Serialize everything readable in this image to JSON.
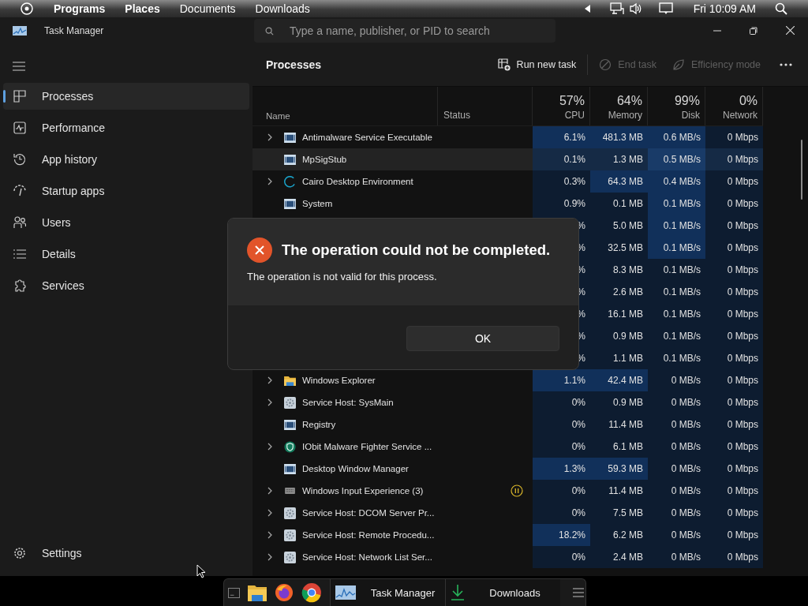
{
  "top_bar": {
    "menu": [
      {
        "label": "Programs",
        "bold": true
      },
      {
        "label": "Places",
        "bold": true
      },
      {
        "label": "Documents",
        "bold": false
      },
      {
        "label": "Downloads",
        "bold": false
      }
    ],
    "clock": "Fri 10:09 AM"
  },
  "window": {
    "title": "Task Manager",
    "search": {
      "placeholder": "Type a name, publisher, or PID to search"
    }
  },
  "sidebar": {
    "items": [
      {
        "label": "Processes",
        "selected": true
      },
      {
        "label": "Performance",
        "selected": false
      },
      {
        "label": "App history",
        "selected": false
      },
      {
        "label": "Startup apps",
        "selected": false
      },
      {
        "label": "Users",
        "selected": false
      },
      {
        "label": "Details",
        "selected": false
      },
      {
        "label": "Services",
        "selected": false
      }
    ],
    "settings": "Settings"
  },
  "toolbar": {
    "title": "Processes",
    "actions": [
      {
        "label": "Run new task",
        "disabled": false
      },
      {
        "label": "End task",
        "disabled": true
      },
      {
        "label": "Efficiency mode",
        "disabled": true
      }
    ]
  },
  "table": {
    "columns": [
      {
        "label": "Name"
      },
      {
        "label": "Status"
      },
      {
        "label": "CPU",
        "total": "57%"
      },
      {
        "label": "Memory",
        "total": "64%"
      },
      {
        "label": "Disk",
        "total": "99%"
      },
      {
        "label": "Network",
        "total": "0%"
      }
    ],
    "rows": [
      {
        "name": "Antimalware Service Executable",
        "kind": "app",
        "expandable": true,
        "selected": false,
        "suspended": false,
        "cpu": {
          "text": "6.1%",
          "hot": true
        },
        "memory": {
          "text": "481.3 MB",
          "hot": true
        },
        "disk": {
          "text": "0.6 MB/s",
          "hot": true
        },
        "network": {
          "text": "0 Mbps",
          "hot": false
        }
      },
      {
        "name": "MpSigStub",
        "kind": "app",
        "expandable": false,
        "selected": true,
        "suspended": false,
        "cpu": {
          "text": "0.1%",
          "hot": false
        },
        "memory": {
          "text": "1.3 MB",
          "hot": false
        },
        "disk": {
          "text": "0.5 MB/s",
          "hot": true
        },
        "network": {
          "text": "0 Mbps",
          "hot": false
        }
      },
      {
        "name": "Cairo Desktop Environment",
        "kind": "ring",
        "expandable": true,
        "selected": false,
        "suspended": false,
        "cpu": {
          "text": "0.3%",
          "hot": false
        },
        "memory": {
          "text": "64.3 MB",
          "hot": true
        },
        "disk": {
          "text": "0.4 MB/s",
          "hot": true
        },
        "network": {
          "text": "0 Mbps",
          "hot": false
        }
      },
      {
        "name": "System",
        "kind": "app",
        "expandable": false,
        "selected": false,
        "suspended": false,
        "cpu": {
          "text": "0.9%",
          "hot": false
        },
        "memory": {
          "text": "0.1 MB",
          "hot": false
        },
        "disk": {
          "text": "0.1 MB/s",
          "hot": true
        },
        "network": {
          "text": "0 Mbps",
          "hot": false
        }
      },
      {
        "selected": false,
        "cpu": {
          "text": "%",
          "hot": false
        },
        "memory": {
          "text": "5.0 MB",
          "hot": false
        },
        "disk": {
          "text": "0.1 MB/s",
          "hot": true
        },
        "network": {
          "text": "0 Mbps",
          "hot": false
        }
      },
      {
        "selected": false,
        "cpu": {
          "text": "%",
          "hot": false
        },
        "memory": {
          "text": "32.5 MB",
          "hot": false
        },
        "disk": {
          "text": "0.1 MB/s",
          "hot": true
        },
        "network": {
          "text": "0 Mbps",
          "hot": false
        }
      },
      {
        "selected": false,
        "cpu": {
          "text": "%",
          "hot": false
        },
        "memory": {
          "text": "8.3 MB",
          "hot": false
        },
        "disk": {
          "text": "0.1 MB/s",
          "hot": false
        },
        "network": {
          "text": "0 Mbps",
          "hot": false
        }
      },
      {
        "selected": false,
        "cpu": {
          "text": "%",
          "hot": false
        },
        "memory": {
          "text": "2.6 MB",
          "hot": false
        },
        "disk": {
          "text": "0.1 MB/s",
          "hot": false
        },
        "network": {
          "text": "0 Mbps",
          "hot": false
        }
      },
      {
        "selected": false,
        "cpu": {
          "text": "%",
          "hot": false
        },
        "memory": {
          "text": "16.1 MB",
          "hot": false
        },
        "disk": {
          "text": "0.1 MB/s",
          "hot": false
        },
        "network": {
          "text": "0 Mbps",
          "hot": false
        }
      },
      {
        "selected": false,
        "cpu": {
          "text": "%",
          "hot": false
        },
        "memory": {
          "text": "0.9 MB",
          "hot": false
        },
        "disk": {
          "text": "0.1 MB/s",
          "hot": false
        },
        "network": {
          "text": "0 Mbps",
          "hot": false
        }
      },
      {
        "selected": false,
        "cpu": {
          "text": "%",
          "hot": false
        },
        "memory": {
          "text": "1.1 MB",
          "hot": false
        },
        "disk": {
          "text": "0.1 MB/s",
          "hot": false
        },
        "network": {
          "text": "0 Mbps",
          "hot": false
        }
      },
      {
        "name": "Windows Explorer",
        "kind": "folder",
        "expandable": true,
        "selected": false,
        "suspended": false,
        "cpu": {
          "text": "1.1%",
          "hot": true
        },
        "memory": {
          "text": "42.4 MB",
          "hot": true
        },
        "disk": {
          "text": "0 MB/s",
          "hot": false
        },
        "network": {
          "text": "0 Mbps",
          "hot": false
        }
      },
      {
        "name": "Service Host: SysMain",
        "kind": "gear",
        "expandable": true,
        "selected": false,
        "suspended": false,
        "cpu": {
          "text": "0%",
          "hot": false
        },
        "memory": {
          "text": "0.9 MB",
          "hot": false
        },
        "disk": {
          "text": "0 MB/s",
          "hot": false
        },
        "network": {
          "text": "0 Mbps",
          "hot": false
        }
      },
      {
        "name": "Registry",
        "kind": "app",
        "expandable": false,
        "selected": false,
        "suspended": false,
        "cpu": {
          "text": "0%",
          "hot": false
        },
        "memory": {
          "text": "11.4 MB",
          "hot": false
        },
        "disk": {
          "text": "0 MB/s",
          "hot": false
        },
        "network": {
          "text": "0 Mbps",
          "hot": false
        }
      },
      {
        "name": "IObit Malware Fighter Service ...",
        "kind": "shield",
        "expandable": true,
        "selected": false,
        "suspended": false,
        "cpu": {
          "text": "0%",
          "hot": false
        },
        "memory": {
          "text": "6.1 MB",
          "hot": false
        },
        "disk": {
          "text": "0 MB/s",
          "hot": false
        },
        "network": {
          "text": "0 Mbps",
          "hot": false
        }
      },
      {
        "name": "Desktop Window Manager",
        "kind": "app",
        "expandable": false,
        "selected": false,
        "suspended": false,
        "cpu": {
          "text": "1.3%",
          "hot": true
        },
        "memory": {
          "text": "59.3 MB",
          "hot": true
        },
        "disk": {
          "text": "0 MB/s",
          "hot": false
        },
        "network": {
          "text": "0 Mbps",
          "hot": false
        }
      },
      {
        "name": "Windows Input Experience (3)",
        "kind": "keyboard",
        "expandable": true,
        "selected": false,
        "suspended": true,
        "cpu": {
          "text": "0%",
          "hot": false
        },
        "memory": {
          "text": "11.4 MB",
          "hot": false
        },
        "disk": {
          "text": "0 MB/s",
          "hot": false
        },
        "network": {
          "text": "0 Mbps",
          "hot": false
        }
      },
      {
        "name": "Service Host: DCOM Server Pr...",
        "kind": "gear",
        "expandable": true,
        "selected": false,
        "suspended": false,
        "cpu": {
          "text": "0%",
          "hot": false
        },
        "memory": {
          "text": "7.5 MB",
          "hot": false
        },
        "disk": {
          "text": "0 MB/s",
          "hot": false
        },
        "network": {
          "text": "0 Mbps",
          "hot": false
        }
      },
      {
        "name": "Service Host: Remote Procedu...",
        "kind": "gear",
        "expandable": true,
        "selected": false,
        "suspended": false,
        "cpu": {
          "text": "18.2%",
          "hot": true
        },
        "memory": {
          "text": "6.2 MB",
          "hot": false
        },
        "disk": {
          "text": "0 MB/s",
          "hot": false
        },
        "network": {
          "text": "0 Mbps",
          "hot": false
        }
      },
      {
        "name": "Service Host: Network List Ser...",
        "kind": "gear",
        "expandable": true,
        "selected": false,
        "suspended": false,
        "cpu": {
          "text": "0%",
          "hot": false
        },
        "memory": {
          "text": "2.4 MB",
          "hot": false
        },
        "disk": {
          "text": "0 MB/s",
          "hot": false
        },
        "network": {
          "text": "0 Mbps",
          "hot": false
        }
      }
    ]
  },
  "dialog": {
    "title": "The operation could not be completed.",
    "message": "The operation is not valid for this process.",
    "button": "OK"
  },
  "taskbar": {
    "tasks": [
      {
        "label": "Task Manager"
      },
      {
        "label": "Downloads"
      }
    ]
  }
}
